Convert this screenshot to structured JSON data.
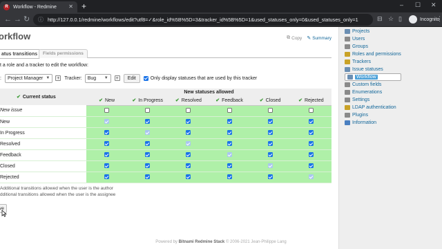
{
  "browser": {
    "tab_title": "Workflow - Redmine",
    "url": "http://127.0.0.1/redmine/workflows/edit?utf8=✓&role_id%5B%5D=3&tracker_id%5B%5D=1&used_statuses_only=0&used_statuses_only=1",
    "profile_label": "Incognito"
  },
  "page": {
    "title": "orkflow",
    "actions": {
      "copy": "Copy",
      "summary": "Summary"
    },
    "tabs": [
      "atus transitions",
      "Fields permissions"
    ],
    "instruction": "t a role and a tracker to edit the workflow:",
    "filter": {
      "role_label": ":",
      "role_value": "Project Manager",
      "tracker_label": "Tracker:",
      "tracker_value": "Bug",
      "edit_label": "Edit",
      "only_used_label": "Only display statuses that are used by this tracker"
    },
    "table": {
      "current_status_header": "Current status",
      "new_statuses_header": "New statuses allowed",
      "columns": [
        "New",
        "In Progress",
        "Resolved",
        "Feedback",
        "Closed",
        "Rejected"
      ],
      "rows": [
        {
          "label": "New issue",
          "italic": true,
          "cells": [
            "off",
            "off",
            "off",
            "off",
            "off",
            "off"
          ]
        },
        {
          "label": "New",
          "italic": false,
          "cells": [
            "dis",
            "on",
            "on",
            "on",
            "on",
            "on"
          ]
        },
        {
          "label": "In Progress",
          "italic": false,
          "cells": [
            "on",
            "dis",
            "on",
            "on",
            "on",
            "on"
          ]
        },
        {
          "label": "Resolved",
          "italic": false,
          "cells": [
            "on",
            "on",
            "dis",
            "on",
            "on",
            "on"
          ]
        },
        {
          "label": "Feedback",
          "italic": false,
          "cells": [
            "on",
            "on",
            "on",
            "dis",
            "on",
            "on"
          ]
        },
        {
          "label": "Closed",
          "italic": false,
          "cells": [
            "on",
            "on",
            "on",
            "on",
            "dis",
            "on"
          ]
        },
        {
          "label": "Rejected",
          "italic": false,
          "cells": [
            "on",
            "on",
            "on",
            "on",
            "on",
            "dis"
          ]
        }
      ]
    },
    "author_transitions": "Additional transitions allowed when the user is the author",
    "assignee_transitions": "dditional transitions allowed when the user is the assignee",
    "save_label": "ve"
  },
  "sidebar": {
    "items": [
      {
        "label": "Projects",
        "color": "#6b8fb3"
      },
      {
        "label": "Users",
        "color": "#8a8a8a"
      },
      {
        "label": "Groups",
        "color": "#8a8a8a"
      },
      {
        "label": "Roles and permissions",
        "color": "#c9a227"
      },
      {
        "label": "Trackers",
        "color": "#c9a227"
      },
      {
        "label": "Issue statuses",
        "color": "#6b8fb3"
      },
      {
        "label": "Workflow",
        "color": "#6b8fb3",
        "selected": true
      },
      {
        "label": "Custom fields",
        "color": "#8a8a8a"
      },
      {
        "label": "Enumerations",
        "color": "#8a8a8a"
      },
      {
        "label": "Settings",
        "color": "#8a8a8a"
      },
      {
        "label": "LDAP authentication",
        "color": "#c9a227"
      },
      {
        "label": "Plugins",
        "color": "#8a8a8a"
      },
      {
        "label": "Information",
        "color": "#4a7fc0"
      }
    ]
  },
  "footer": {
    "powered_by": "Powered by",
    "product": "Bitnami Redmine Stack",
    "copyright": "© 2006-2021 Jean-Philippe Lang"
  }
}
